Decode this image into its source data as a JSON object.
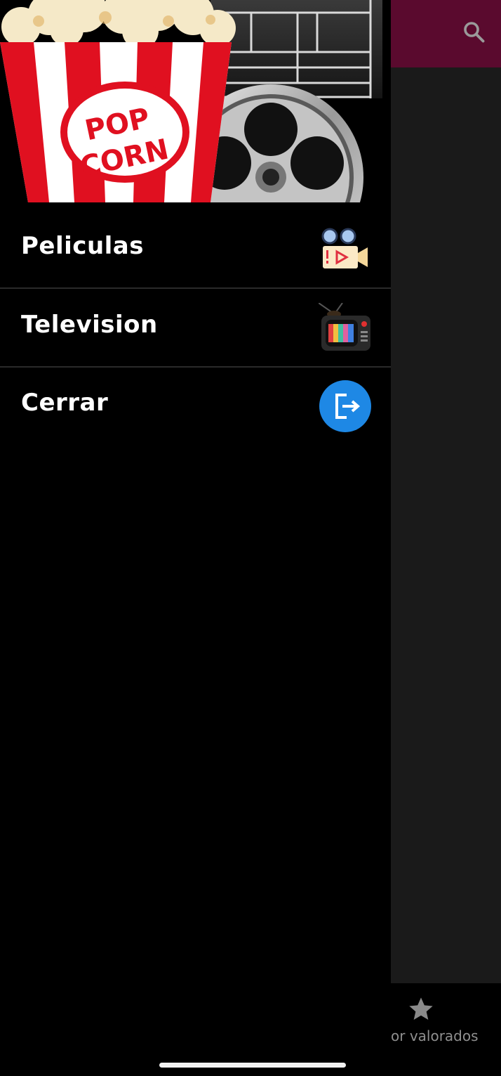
{
  "app_bar": {
    "search_icon": "search-icon",
    "color": "#5a0a2e"
  },
  "drawer": {
    "header_image": "popcorn-film-reel-banner",
    "items": [
      {
        "label": "Peliculas",
        "icon": "movie-camera-icon"
      },
      {
        "label": "Television",
        "icon": "retro-tv-icon"
      },
      {
        "label": "Cerrar",
        "icon": "logout-icon",
        "icon_color": "#1e88e5"
      }
    ]
  },
  "bottom_nav": {
    "visible_item": {
      "label": "or valorados",
      "icon": "star-icon"
    }
  }
}
